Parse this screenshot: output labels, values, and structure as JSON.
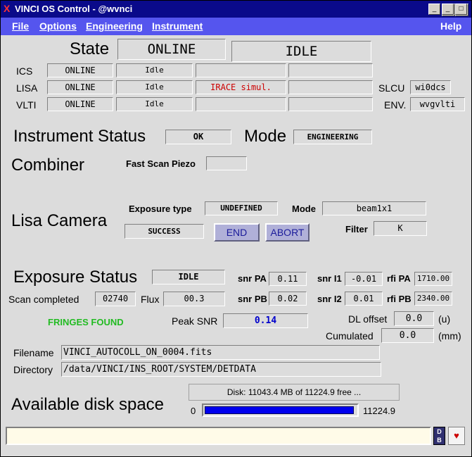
{
  "window": {
    "title": "VINCI OS Control - @wvnci"
  },
  "menu": {
    "file": "File",
    "options": "Options",
    "engineering": "Engineering",
    "instrument": "Instrument",
    "help": "Help"
  },
  "state": {
    "label": "State",
    "value": "ONLINE",
    "sub": "IDLE"
  },
  "subsystems": [
    {
      "name": "ICS",
      "state": "ONLINE",
      "sub": "Idle",
      "c3": "",
      "c4": ""
    },
    {
      "name": "LISA",
      "state": "ONLINE",
      "sub": "Idle",
      "c3": "IRACE simul.",
      "c4": ""
    },
    {
      "name": "VLTI",
      "state": "ONLINE",
      "sub": "Idle",
      "c3": "",
      "c4": ""
    }
  ],
  "slcu": {
    "label": "SLCU",
    "value": "wi0dcs"
  },
  "env": {
    "label": "ENV.",
    "value": "wvgvlti"
  },
  "instrument": {
    "status_label": "Instrument Status",
    "status": "OK",
    "mode_label": "Mode",
    "mode": "ENGINEERING"
  },
  "combiner": {
    "label": "Combiner",
    "fsp_label": "Fast Scan Piezo",
    "fsp_value": ""
  },
  "lisa": {
    "label": "Lisa Camera",
    "exp_type_label": "Exposure type",
    "exp_type": "UNDEFINED",
    "mode_label": "Mode",
    "mode": "beam1x1",
    "result": "SUCCESS",
    "end": "END",
    "abort": "ABORT",
    "filter_label": "Filter",
    "filter": "K"
  },
  "exposure": {
    "label": "Exposure Status",
    "status": "IDLE",
    "snr_pa_label": "snr PA",
    "snr_pa": "0.11",
    "snr_pb_label": "snr PB",
    "snr_pb": "0.02",
    "snr_i1_label": "snr I1",
    "snr_i1": "-0.01",
    "snr_i2_label": "snr I2",
    "snr_i2": "0.01",
    "rfi_pa_label": "rfi PA",
    "rfi_pa": "1710.00",
    "rfi_pb_label": "rfi PB",
    "rfi_pb": "2340.00",
    "scan_label": "Scan completed",
    "scan": "02740",
    "flux_label": "Flux",
    "flux": "00.3",
    "fringes": "FRINGES FOUND",
    "peak_label": "Peak SNR",
    "peak": "0.14",
    "dl_label": "DL offset",
    "dl": "0.0",
    "dl_unit": "(u)",
    "cum_label": "Cumulated",
    "cum": "0.0",
    "cum_unit": "(mm)"
  },
  "files": {
    "filename_label": "Filename",
    "filename": "VINCI_AUTOCOLL_ON_0004.fits",
    "directory_label": "Directory",
    "directory": "/data/VINCI/INS_ROOT/SYSTEM/DETDATA"
  },
  "disk": {
    "label": "Available disk space",
    "button": "Disk: 11043.4 MB of 11224.9 free ...",
    "min": "0",
    "max": "11224.9",
    "fraction": 0.984
  },
  "colors": {
    "title_bg": "#0a0a8a",
    "menu_bg": "#5555ee",
    "fringes": "#22bb22",
    "peak": "#0000cc",
    "irace": "#cc0000",
    "progress": "#0000ee"
  }
}
